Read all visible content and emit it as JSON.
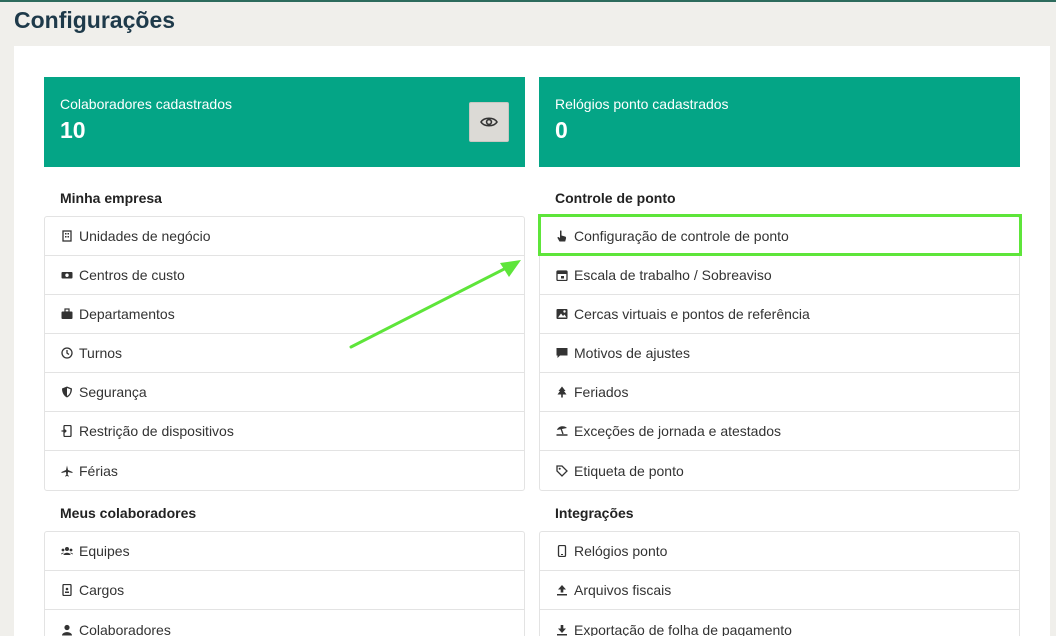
{
  "page": {
    "title": "Configurações"
  },
  "stats": {
    "employees": {
      "label": "Colaboradores cadastrados",
      "value": "10"
    },
    "clocks": {
      "label": "Relógios ponto cadastrados",
      "value": "0"
    }
  },
  "sections": {
    "minha_empresa": {
      "title": "Minha empresa",
      "items": [
        {
          "label": "Unidades de negócio",
          "icon": "building-icon"
        },
        {
          "label": "Centros de custo",
          "icon": "money-icon"
        },
        {
          "label": "Departamentos",
          "icon": "briefcase-icon"
        },
        {
          "label": "Turnos",
          "icon": "clock-icon"
        },
        {
          "label": "Segurança",
          "icon": "shield-icon"
        },
        {
          "label": "Restrição de dispositivos",
          "icon": "device-lock-icon"
        },
        {
          "label": "Férias",
          "icon": "plane-icon"
        }
      ]
    },
    "controle_de_ponto": {
      "title": "Controle de ponto",
      "items": [
        {
          "label": "Configuração de controle de ponto",
          "icon": "hand-pointer-icon"
        },
        {
          "label": "Escala de trabalho / Sobreaviso",
          "icon": "calendar-icon"
        },
        {
          "label": "Cercas virtuais e pontos de referência",
          "icon": "map-image-icon"
        },
        {
          "label": "Motivos de ajustes",
          "icon": "comment-icon"
        },
        {
          "label": "Feriados",
          "icon": "tree-icon"
        },
        {
          "label": "Exceções de jornada e atestados",
          "icon": "umbrella-beach-icon"
        },
        {
          "label": "Etiqueta de ponto",
          "icon": "tag-icon"
        }
      ]
    },
    "meus_colaboradores": {
      "title": "Meus colaboradores",
      "items": [
        {
          "label": "Equipes",
          "icon": "users-icon"
        },
        {
          "label": "Cargos",
          "icon": "id-badge-icon"
        },
        {
          "label": "Colaboradores",
          "icon": "user-icon"
        }
      ]
    },
    "integracoes": {
      "title": "Integrações",
      "items": [
        {
          "label": "Relógios ponto",
          "icon": "mobile-icon"
        },
        {
          "label": "Arquivos fiscais",
          "icon": "upload-icon"
        },
        {
          "label": "Exportação de folha de pagamento",
          "icon": "download-icon"
        }
      ]
    }
  },
  "colors": {
    "accent": "#04a586",
    "highlight": "#5ee53a",
    "title": "#1e3a4a"
  }
}
